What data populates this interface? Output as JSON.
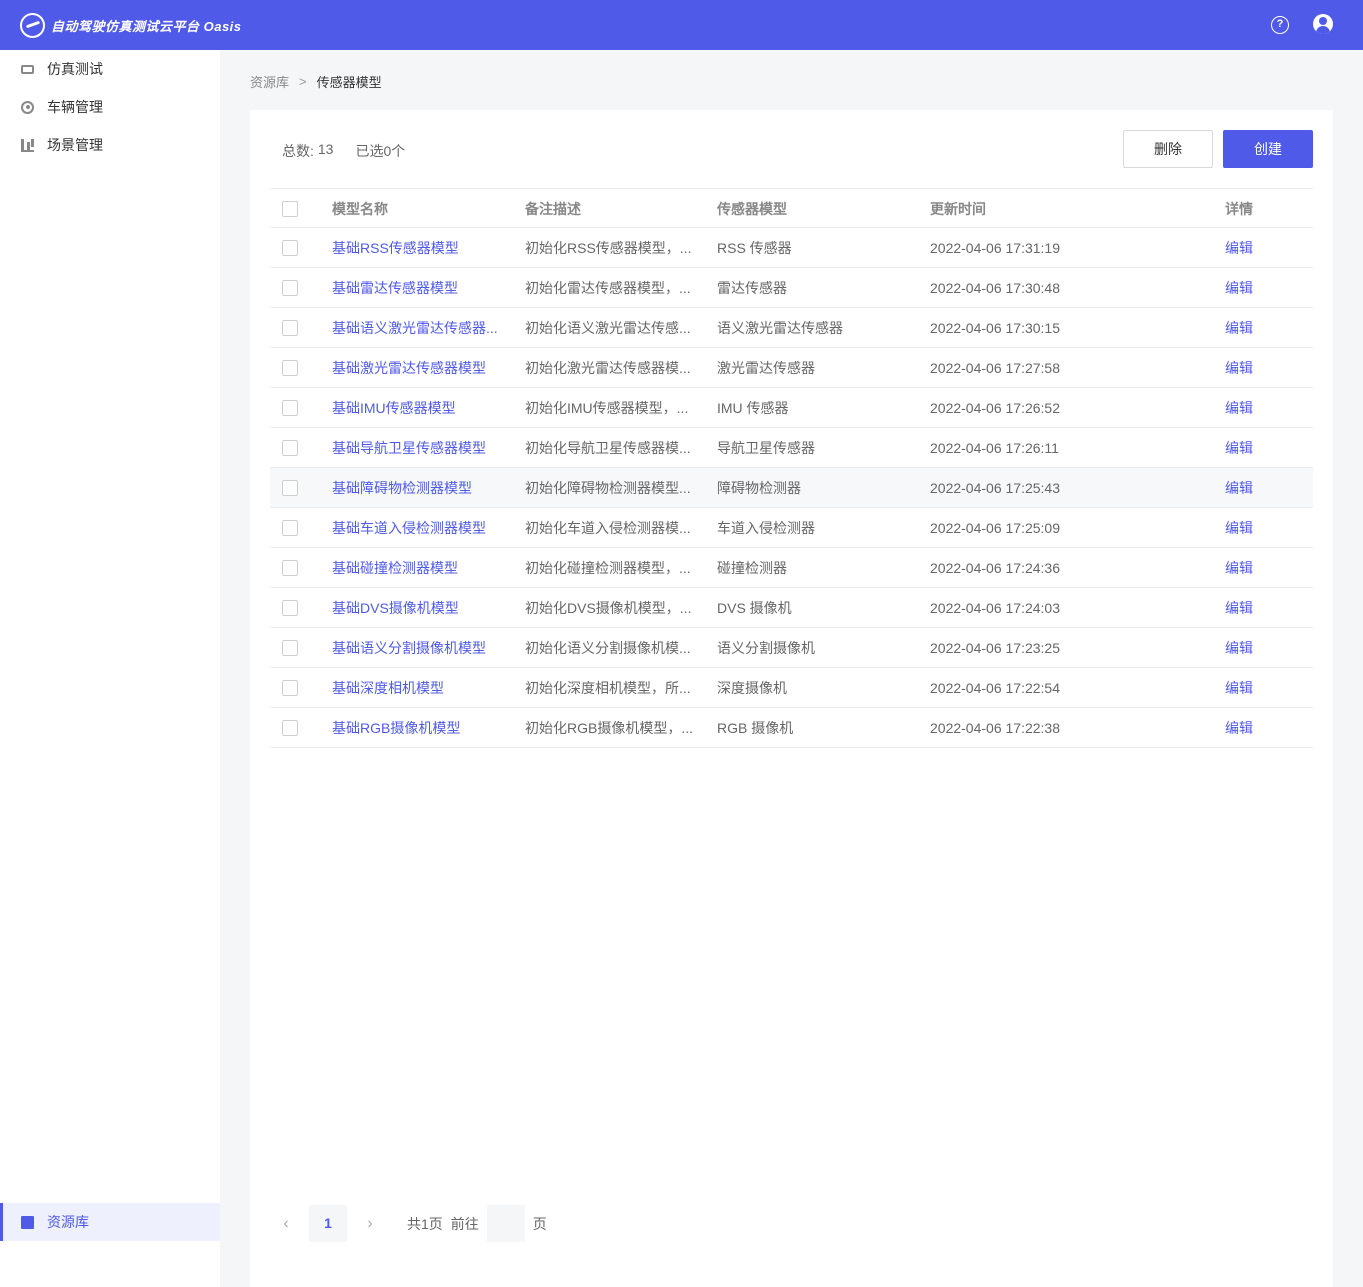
{
  "header": {
    "title": "自动驾驶仿真测试云平台 Oasis",
    "help_icon_char": "?"
  },
  "sidebar": {
    "items": [
      {
        "label": "仿真测试",
        "icon": "monitor-icon"
      },
      {
        "label": "车辆管理",
        "icon": "wheel-icon"
      },
      {
        "label": "场景管理",
        "icon": "scene-icon"
      }
    ],
    "bottom_item": {
      "label": "资源库",
      "icon": "book-icon",
      "active": true
    }
  },
  "breadcrumb": {
    "root": "资源库",
    "separator": ">",
    "current": "传感器模型"
  },
  "summary": {
    "total_label": "总数:",
    "total_value": "13",
    "selected_label": "已选0个"
  },
  "buttons": {
    "delete": "删除",
    "create": "创建"
  },
  "table": {
    "columns": [
      "模型名称",
      "备注描述",
      "传感器模型",
      "更新时间",
      "详情"
    ],
    "rows": [
      {
        "name": "基础RSS传感器模型",
        "desc": "初始化RSS传感器模型，...",
        "model": "RSS 传感器",
        "time": "2022-04-06 17:31:19",
        "action": "编辑"
      },
      {
        "name": "基础雷达传感器模型",
        "desc": "初始化雷达传感器模型，...",
        "model": "雷达传感器",
        "time": "2022-04-06 17:30:48",
        "action": "编辑"
      },
      {
        "name": "基础语义激光雷达传感器...",
        "desc": "初始化语义激光雷达传感...",
        "model": "语义激光雷达传感器",
        "time": "2022-04-06 17:30:15",
        "action": "编辑"
      },
      {
        "name": "基础激光雷达传感器模型",
        "desc": "初始化激光雷达传感器模...",
        "model": "激光雷达传感器",
        "time": "2022-04-06 17:27:58",
        "action": "编辑"
      },
      {
        "name": "基础IMU传感器模型",
        "desc": "初始化IMU传感器模型，...",
        "model": "IMU 传感器",
        "time": "2022-04-06 17:26:52",
        "action": "编辑"
      },
      {
        "name": "基础导航卫星传感器模型",
        "desc": "初始化导航卫星传感器模...",
        "model": "导航卫星传感器",
        "time": "2022-04-06 17:26:11",
        "action": "编辑"
      },
      {
        "name": "基础障碍物检测器模型",
        "desc": "初始化障碍物检测器模型...",
        "model": "障碍物检测器",
        "time": "2022-04-06 17:25:43",
        "action": "编辑"
      },
      {
        "name": "基础车道入侵检测器模型",
        "desc": "初始化车道入侵检测器模...",
        "model": "车道入侵检测器",
        "time": "2022-04-06 17:25:09",
        "action": "编辑"
      },
      {
        "name": "基础碰撞检测器模型",
        "desc": "初始化碰撞检测器模型，...",
        "model": "碰撞检测器",
        "time": "2022-04-06 17:24:36",
        "action": "编辑"
      },
      {
        "name": "基础DVS摄像机模型",
        "desc": "初始化DVS摄像机模型，...",
        "model": "DVS 摄像机",
        "time": "2022-04-06 17:24:03",
        "action": "编辑"
      },
      {
        "name": "基础语义分割摄像机模型",
        "desc": "初始化语义分割摄像机模...",
        "model": "语义分割摄像机",
        "time": "2022-04-06 17:23:25",
        "action": "编辑"
      },
      {
        "name": "基础深度相机模型",
        "desc": "初始化深度相机模型，所...",
        "model": "深度摄像机",
        "time": "2022-04-06 17:22:54",
        "action": "编辑"
      },
      {
        "name": "基础RGB摄像机模型",
        "desc": "初始化RGB摄像机模型，...",
        "model": "RGB 摄像机",
        "time": "2022-04-06 17:22:38",
        "action": "编辑"
      }
    ]
  },
  "pagination": {
    "prev": "‹",
    "current_page": "1",
    "next": "›",
    "total_pages_text": "共1页",
    "goto_label": "前往",
    "page_suffix": "页"
  },
  "colors": {
    "accent": "#4f5ae8"
  }
}
